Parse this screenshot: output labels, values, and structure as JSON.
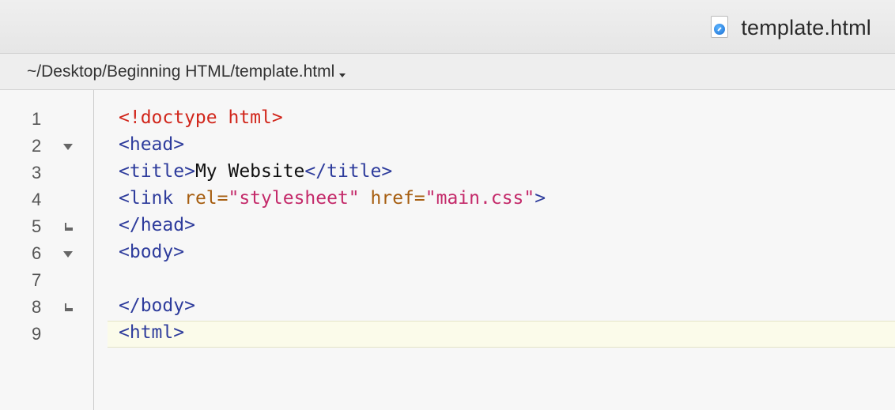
{
  "titlebar": {
    "document_title": "template.html",
    "file_icon": "html-file-icon"
  },
  "pathbar": {
    "path": "~/Desktop/Beginning HTML/template.html"
  },
  "editor": {
    "current_line": 9,
    "colors": {
      "doctype": "#d1261b",
      "tag": "#2e3c9c",
      "attribute": "#a65d0f",
      "string": "#c42a6a",
      "text": "#111111",
      "current_line_highlight": "#fbfbea"
    },
    "lines": [
      {
        "number": "1",
        "fold": "none",
        "tokens": [
          {
            "type": "doctype",
            "text": "<!doctype html>"
          }
        ]
      },
      {
        "number": "2",
        "fold": "open",
        "tokens": [
          {
            "type": "tag",
            "text": "<head>"
          }
        ]
      },
      {
        "number": "3",
        "fold": "none",
        "tokens": [
          {
            "type": "tag",
            "text": "<title>"
          },
          {
            "type": "plain",
            "text": "My Website"
          },
          {
            "type": "tag",
            "text": "</title>"
          }
        ]
      },
      {
        "number": "4",
        "fold": "none",
        "tokens": [
          {
            "type": "tag",
            "text": "<link "
          },
          {
            "type": "attr",
            "text": "rel="
          },
          {
            "type": "str",
            "text": "\"stylesheet\""
          },
          {
            "type": "plain",
            "text": " "
          },
          {
            "type": "attr",
            "text": "href="
          },
          {
            "type": "str",
            "text": "\"main.css\""
          },
          {
            "type": "tag",
            "text": ">"
          }
        ]
      },
      {
        "number": "5",
        "fold": "end",
        "tokens": [
          {
            "type": "tag",
            "text": "</head>"
          }
        ]
      },
      {
        "number": "6",
        "fold": "open",
        "tokens": [
          {
            "type": "tag",
            "text": "<body>"
          }
        ]
      },
      {
        "number": "7",
        "fold": "none",
        "tokens": []
      },
      {
        "number": "8",
        "fold": "end",
        "tokens": [
          {
            "type": "tag",
            "text": "</body>"
          }
        ]
      },
      {
        "number": "9",
        "fold": "none",
        "tokens": [
          {
            "type": "tag",
            "text": "<html>"
          }
        ]
      }
    ]
  }
}
